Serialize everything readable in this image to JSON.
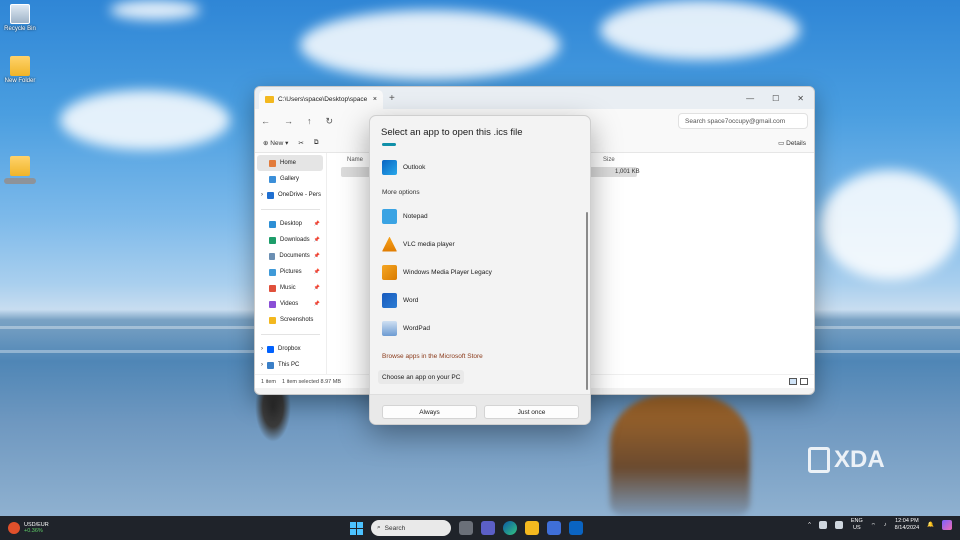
{
  "desktop": {
    "icons": [
      {
        "label": "Recycle Bin"
      },
      {
        "label": "New Folder"
      }
    ],
    "watermark": "XDA"
  },
  "explorer": {
    "tab_title": "C:\\Users\\space\\Desktop\\space",
    "search_placeholder": "Search space7occupy@gmail.com",
    "new_label": "New",
    "details_label": "Details",
    "nav": {
      "home": "Home",
      "gallery": "Gallery",
      "onedrive": "OneDrive - Pers",
      "desktop": "Desktop",
      "downloads": "Downloads",
      "documents": "Documents",
      "pictures": "Pictures",
      "music": "Music",
      "videos": "Videos",
      "screenshots": "Screenshots",
      "dropbox": "Dropbox",
      "thispc": "This PC"
    },
    "columns": {
      "name": "Name",
      "size": "Size"
    },
    "file_size": "1,001 KB",
    "status": {
      "items": "1 item",
      "selected": "1 item selected  8.97 MB"
    }
  },
  "dialog": {
    "title": "Select an app to open this .ics file",
    "recommended": "Outlook",
    "more_options": "More options",
    "apps": [
      "Notepad",
      "VLC media player",
      "Windows Media Player Legacy",
      "Word",
      "WordPad"
    ],
    "store_link": "Browse apps in the Microsoft Store",
    "choose_button": "Choose an app on your PC",
    "always": "Always",
    "just_once": "Just once"
  },
  "taskbar": {
    "widget_title": "USD/EUR",
    "widget_value": "+0.36%",
    "search_placeholder": "Search",
    "lang_line1": "ENG",
    "lang_line2": "US",
    "time": "12:04 PM",
    "date": "8/14/2024"
  },
  "colors": {
    "accent": "#0f8fa8",
    "store_link": "#8a3a1a",
    "taskbar": "#1f232a"
  }
}
